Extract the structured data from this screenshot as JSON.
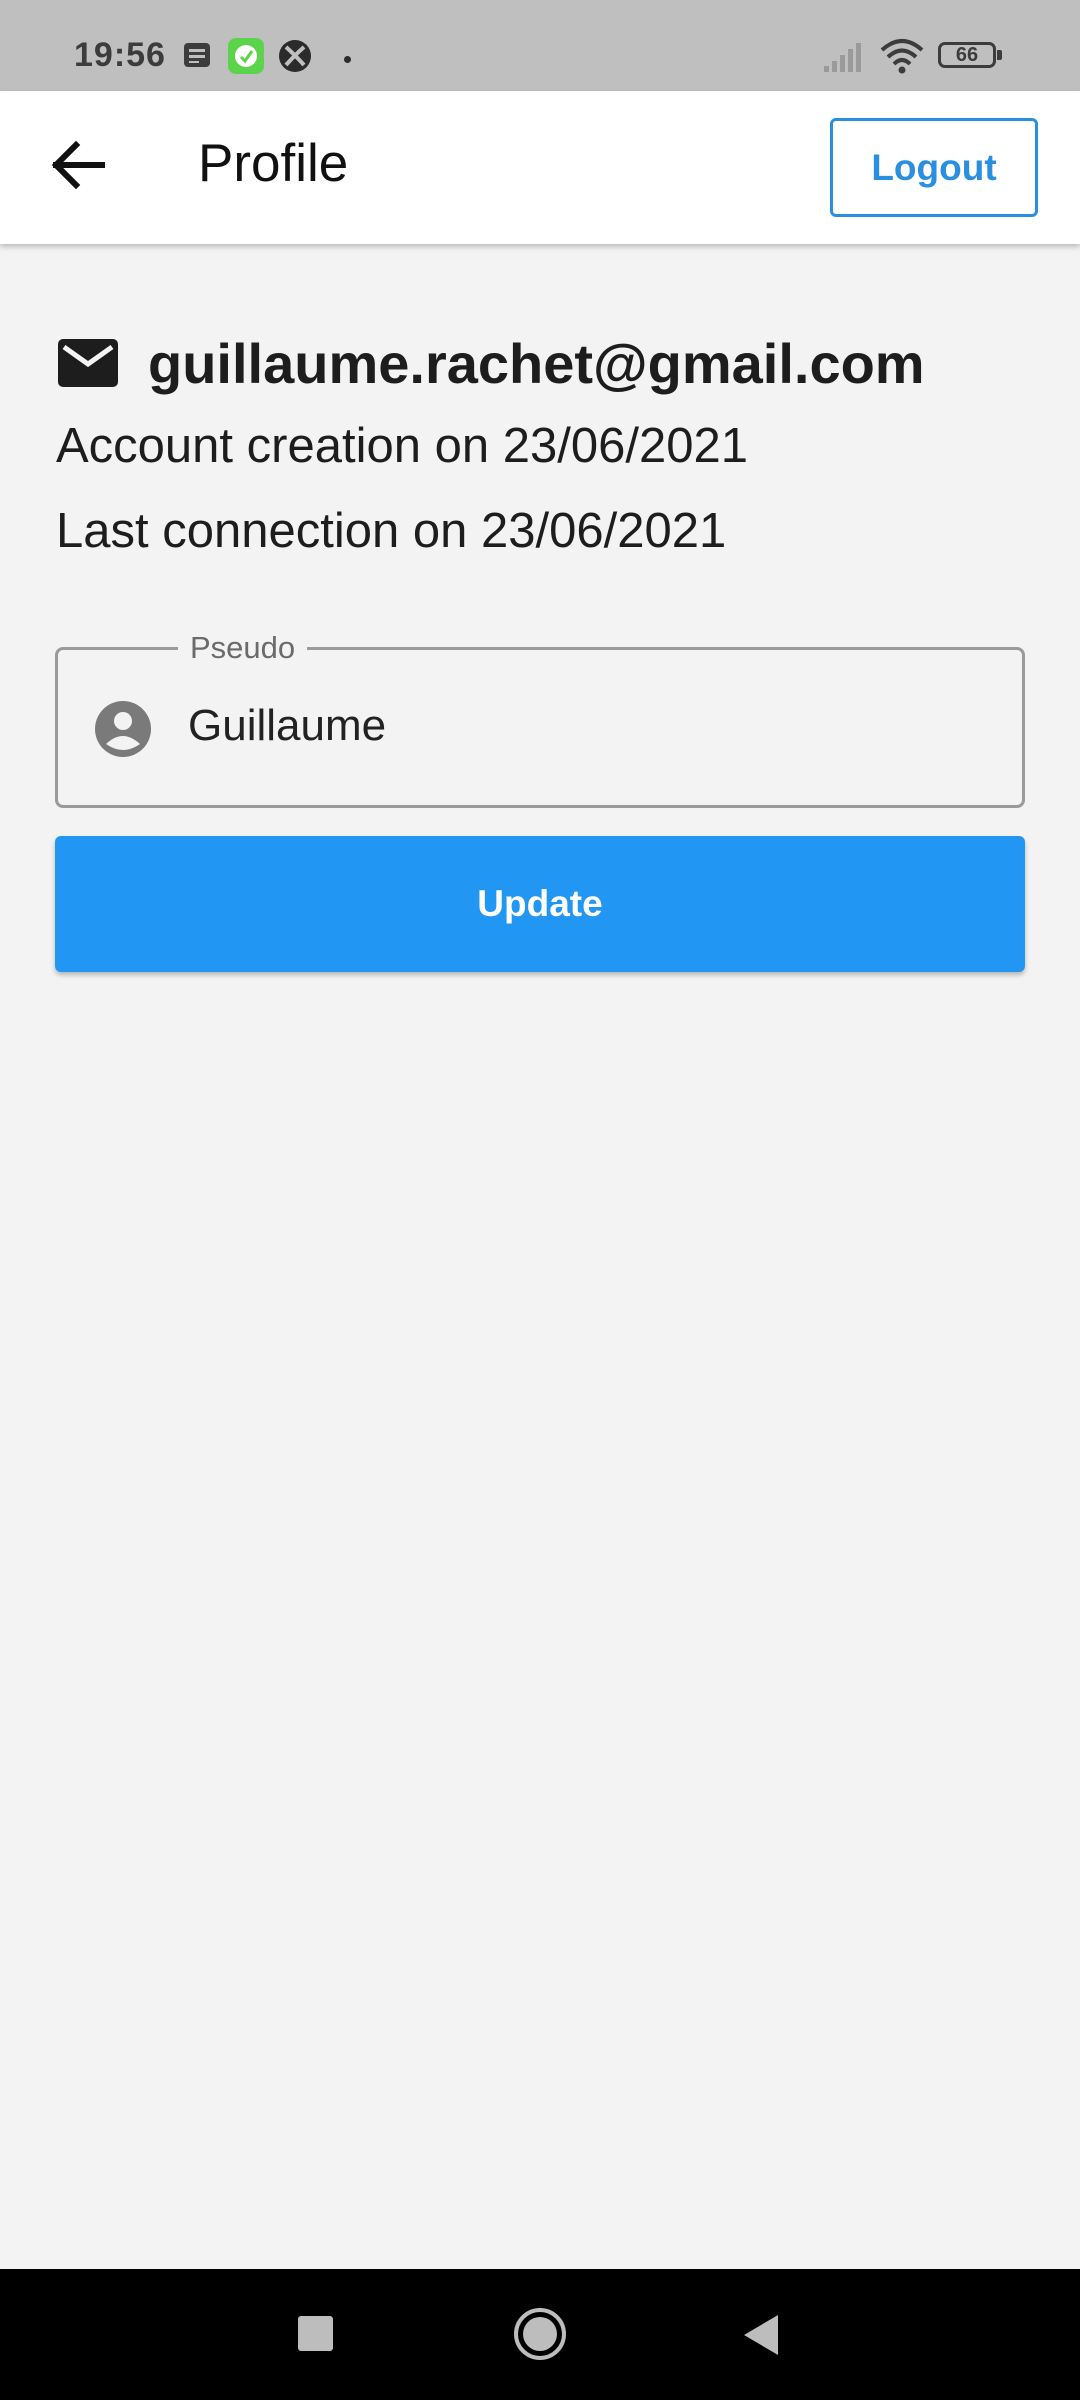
{
  "status_bar": {
    "time": "19:56",
    "battery_level": "66",
    "notification_icons": [
      "message-icon",
      "app-icon",
      "xbox-icon",
      "dot-icon"
    ],
    "system_icons": [
      "signal-icon",
      "wifi-icon",
      "battery-icon"
    ]
  },
  "app_bar": {
    "title": "Profile",
    "logout_label": "Logout",
    "back_icon": "arrow-left-icon"
  },
  "profile": {
    "email": "guillaume.rachet@gmail.com",
    "email_icon": "mail-icon",
    "account_creation": "Account creation on 23/06/2021",
    "last_connection": "Last connection on 23/06/2021"
  },
  "pseudo_field": {
    "label": "Pseudo",
    "value": "Guillaume",
    "icon": "account-circle-icon"
  },
  "update_button": {
    "label": "Update"
  },
  "colors": {
    "primary": "#2196f3",
    "logout_accent": "#2b8fdf",
    "background": "#f3f3f3",
    "status_bar": "#bfbfbf",
    "nav_bar": "#000000"
  }
}
